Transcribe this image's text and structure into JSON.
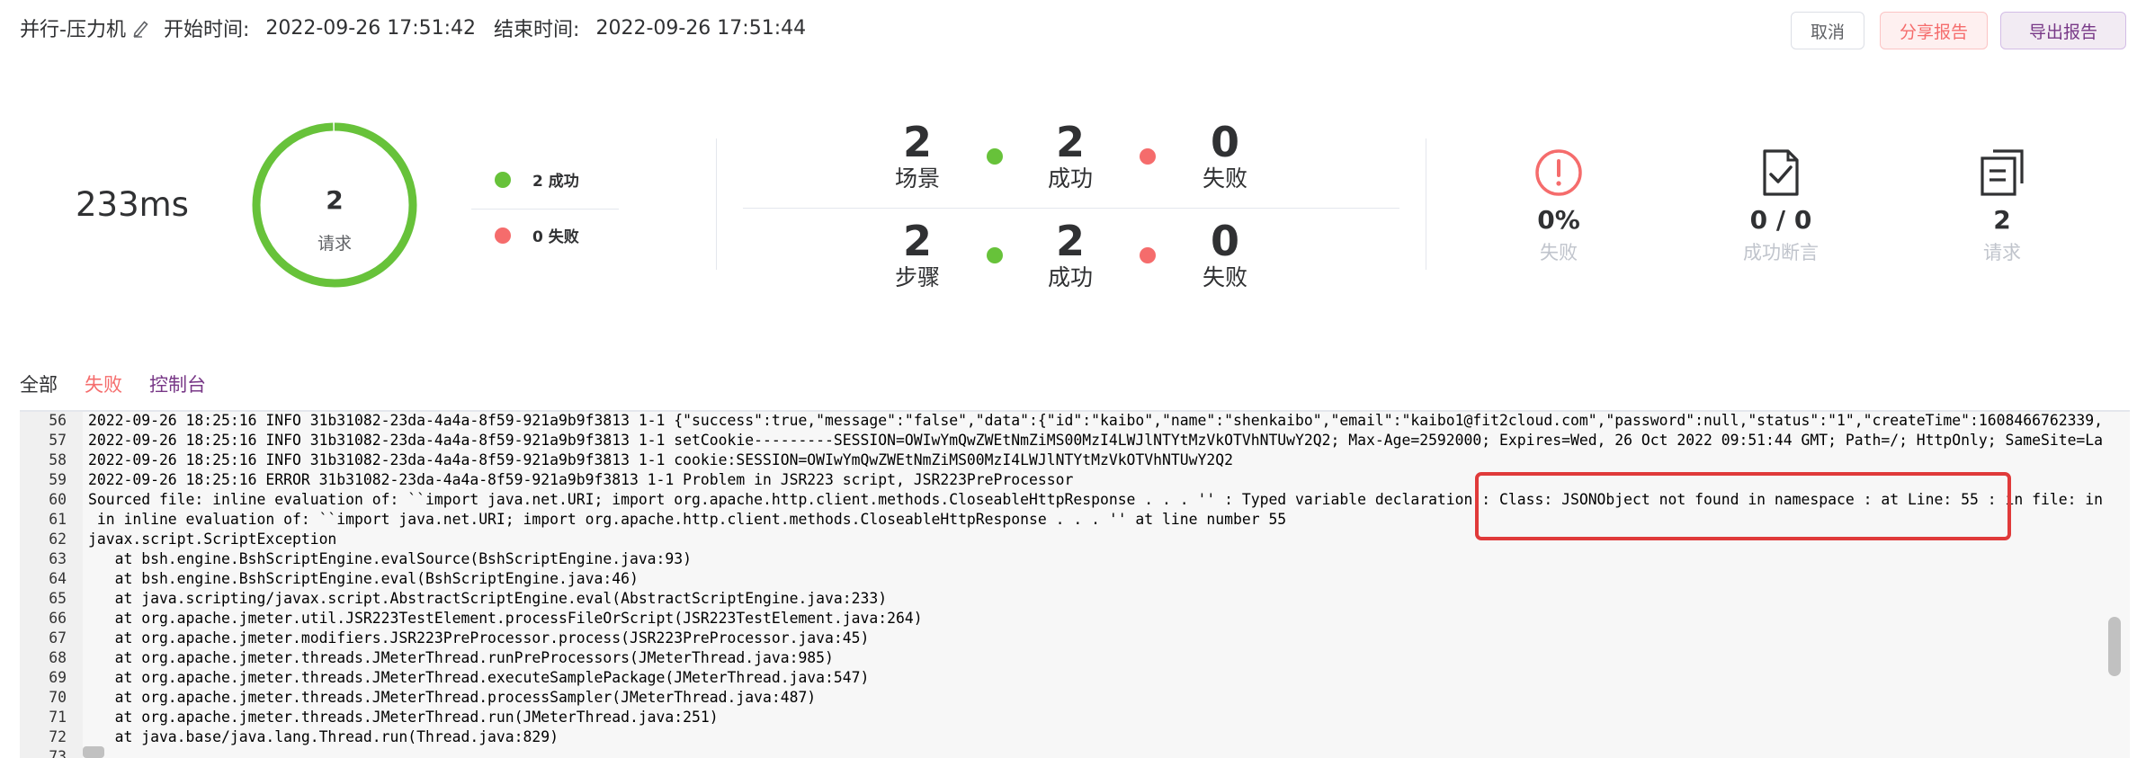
{
  "header": {
    "title": "并行-压力机",
    "start_label": "开始时间:",
    "start_time": "2022-09-26 17:51:42",
    "end_label": "结束时间:",
    "end_time": "2022-09-26 17:51:44",
    "edit_icon": "pencil-icon"
  },
  "actions": {
    "cancel": "取消",
    "share": "分享报告",
    "export": "导出报告"
  },
  "summary": {
    "response_time": "233ms",
    "ring": {
      "count": "2",
      "label": "请求",
      "success_fraction": 1.0
    },
    "legend": {
      "success": "2 成功",
      "fail": "0 失败"
    },
    "scenario": {
      "total": "2",
      "total_label": "场景",
      "success": "2",
      "success_label": "成功",
      "fail": "0",
      "fail_label": "失败"
    },
    "step": {
      "total": "2",
      "total_label": "步骤",
      "success": "2",
      "success_label": "成功",
      "fail": "0",
      "fail_label": "失败"
    },
    "right": [
      {
        "icon": "error-circle-icon",
        "value": "0%",
        "label": "失败"
      },
      {
        "icon": "assertion-doc-icon",
        "value": "0 / 0",
        "label": "成功断言"
      },
      {
        "icon": "request-copy-icon",
        "value": "2",
        "label": "请求"
      }
    ]
  },
  "tabs": [
    "全部",
    "失败",
    "控制台"
  ],
  "active_tab": "控制台",
  "console": {
    "lines": [
      {
        "n": "56",
        "t": "2022-09-26 18:25:16 INFO 31b31082-23da-4a4a-8f59-921a9b9f3813 1-1 {\"success\":true,\"message\":\"false\",\"data\":{\"id\":\"kaibo\",\"name\":\"shenkaibo\",\"email\":\"kaibo1@fit2cloud.com\",\"password\":null,\"status\":\"1\",\"createTime\":1608466762339,"
      },
      {
        "n": "57",
        "t": "2022-09-26 18:25:16 INFO 31b31082-23da-4a4a-8f59-921a9b9f3813 1-1 setCookie---------SESSION=OWIwYmQwZWEtNmZiMS00MzI4LWJlNTYtMzVkOTVhNTUwY2Q2; Max-Age=2592000; Expires=Wed, 26 Oct 2022 09:51:44 GMT; Path=/; HttpOnly; SameSite=La"
      },
      {
        "n": "58",
        "t": "2022-09-26 18:25:16 INFO 31b31082-23da-4a4a-8f59-921a9b9f3813 1-1 cookie:SESSION=OWIwYmQwZWEtNmZiMS00MzI4LWJlNTYtMzVkOTVhNTUwY2Q2"
      },
      {
        "n": "59",
        "t": "2022-09-26 18:25:16 ERROR 31b31082-23da-4a4a-8f59-921a9b9f3813 1-1 Problem in JSR223 script, JSR223PreProcessor"
      },
      {
        "n": "60",
        "t": "Sourced file: inline evaluation of: ``import java.net.URI; import org.apache.http.client.methods.CloseableHttpResponse . . . '' : Typed variable declaration : Class: JSONObject not found in namespace : at Line: 55 : in file: in"
      },
      {
        "n": "61",
        "t": " in inline evaluation of: ``import java.net.URI; import org.apache.http.client.methods.CloseableHttpResponse . . . '' at line number 55"
      },
      {
        "n": "62",
        "t": "javax.script.ScriptException"
      },
      {
        "n": "63",
        "t": "   at bsh.engine.BshScriptEngine.evalSource(BshScriptEngine.java:93)"
      },
      {
        "n": "64",
        "t": "   at bsh.engine.BshScriptEngine.eval(BshScriptEngine.java:46)"
      },
      {
        "n": "65",
        "t": "   at java.scripting/javax.script.AbstractScriptEngine.eval(AbstractScriptEngine.java:233)"
      },
      {
        "n": "66",
        "t": "   at org.apache.jmeter.util.JSR223TestElement.processFileOrScript(JSR223TestElement.java:264)"
      },
      {
        "n": "67",
        "t": "   at org.apache.jmeter.modifiers.JSR223PreProcessor.process(JSR223PreProcessor.java:45)"
      },
      {
        "n": "68",
        "t": "   at org.apache.jmeter.threads.JMeterThread.runPreProcessors(JMeterThread.java:985)"
      },
      {
        "n": "69",
        "t": "   at org.apache.jmeter.threads.JMeterThread.executeSamplePackage(JMeterThread.java:547)"
      },
      {
        "n": "70",
        "t": "   at org.apache.jmeter.threads.JMeterThread.processSampler(JMeterThread.java:487)"
      },
      {
        "n": "71",
        "t": "   at org.apache.jmeter.threads.JMeterThread.run(JMeterThread.java:251)"
      },
      {
        "n": "72",
        "t": "   at java.base/java.lang.Thread.run(Thread.java:829)"
      },
      {
        "n": "73",
        "t": ""
      }
    ]
  },
  "colors": {
    "accent": "#783887",
    "success": "#67c23a",
    "fail": "#f56c6c",
    "highlight": "#e03a3a"
  }
}
